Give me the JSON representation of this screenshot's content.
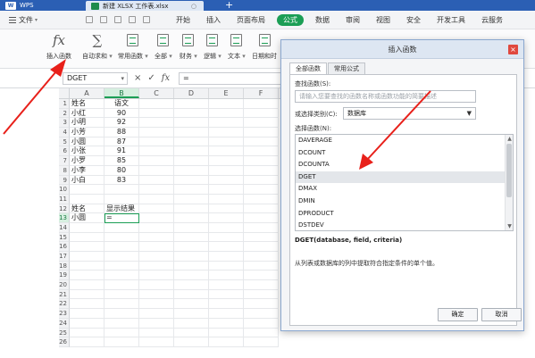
{
  "titlebar": {
    "app_name": "WPS",
    "file_tab": "新建 XLSX 工作表.xlsx",
    "new_tab_symbol": "+"
  },
  "menubar": {
    "file_label": "文件",
    "tabs": [
      "开始",
      "插入",
      "页面布局",
      "公式",
      "数据",
      "审阅",
      "视图",
      "安全",
      "开发工具",
      "云服务"
    ],
    "active_tab": "公式"
  },
  "ribbon": {
    "insert_function": {
      "icon": "fx",
      "label": "插入函数"
    },
    "autosum": {
      "icon": "∑",
      "label": "自动求和"
    },
    "buttons": [
      {
        "name": "common-functions-button",
        "label": "常用函数"
      },
      {
        "name": "all-functions-button",
        "label": "全部"
      },
      {
        "name": "finance-button",
        "label": "财务"
      },
      {
        "name": "logic-button",
        "label": "逻辑"
      },
      {
        "name": "text-button",
        "label": "文本"
      },
      {
        "name": "datetime-button",
        "label": "日期和时"
      }
    ]
  },
  "formula_bar": {
    "name_box": "DGET",
    "cancel_icon": "×",
    "enter_icon": "✓",
    "fx_icon": "fx",
    "formula": "="
  },
  "sheet": {
    "columns": [
      "A",
      "B",
      "C",
      "D",
      "E",
      "F"
    ],
    "selected_column": "B",
    "selected_row": 13,
    "rows": [
      {
        "n": 1,
        "a": "姓名",
        "b": "语文"
      },
      {
        "n": 2,
        "a": "小红",
        "b": "90"
      },
      {
        "n": 3,
        "a": "小明",
        "b": "92"
      },
      {
        "n": 4,
        "a": "小芳",
        "b": "88"
      },
      {
        "n": 5,
        "a": "小圆",
        "b": "87"
      },
      {
        "n": 6,
        "a": "小张",
        "b": "91"
      },
      {
        "n": 7,
        "a": "小罗",
        "b": "85"
      },
      {
        "n": 8,
        "a": "小李",
        "b": "80"
      },
      {
        "n": 9,
        "a": "小白",
        "b": "83"
      },
      {
        "n": 10,
        "a": "",
        "b": ""
      },
      {
        "n": 11,
        "a": "",
        "b": ""
      },
      {
        "n": 12,
        "a": "姓名",
        "b": "显示结果"
      },
      {
        "n": 13,
        "a": "小圆",
        "b": "="
      },
      {
        "n": 14,
        "a": "",
        "b": ""
      },
      {
        "n": 15,
        "a": "",
        "b": ""
      },
      {
        "n": 16,
        "a": "",
        "b": ""
      },
      {
        "n": 17,
        "a": "",
        "b": ""
      },
      {
        "n": 18,
        "a": "",
        "b": ""
      },
      {
        "n": 19,
        "a": "",
        "b": ""
      },
      {
        "n": 20,
        "a": "",
        "b": ""
      },
      {
        "n": 21,
        "a": "",
        "b": ""
      },
      {
        "n": 22,
        "a": "",
        "b": ""
      },
      {
        "n": 23,
        "a": "",
        "b": ""
      },
      {
        "n": 24,
        "a": "",
        "b": ""
      },
      {
        "n": 25,
        "a": "",
        "b": ""
      },
      {
        "n": 26,
        "a": "",
        "b": ""
      }
    ]
  },
  "dialog": {
    "title": "插入函数",
    "close_icon": "×",
    "tabs": [
      "全部函数",
      "常用公式"
    ],
    "search_label": "查找函数(S):",
    "search_placeholder": "请输入您要查找的函数名称或函数功能的简要描述",
    "category_label": "或选择类别(C):",
    "category_value": "数据库",
    "list_label": "选择函数(N):",
    "functions": [
      "DAVERAGE",
      "DCOUNT",
      "DCOUNTA",
      "DGET",
      "DMAX",
      "DMIN",
      "DPRODUCT",
      "DSTDEV"
    ],
    "selected_function": "DGET",
    "signature": "DGET(database, field, criteria)",
    "description": "从列表或数据库的列中提取符合指定条件的单个值。",
    "ok_label": "确定",
    "cancel_label": "取消"
  },
  "colors": {
    "title_blue": "#2b5fb4",
    "accent_green": "#1b9e55",
    "arrow_red": "#e8201a",
    "close_red": "#e0483e"
  }
}
